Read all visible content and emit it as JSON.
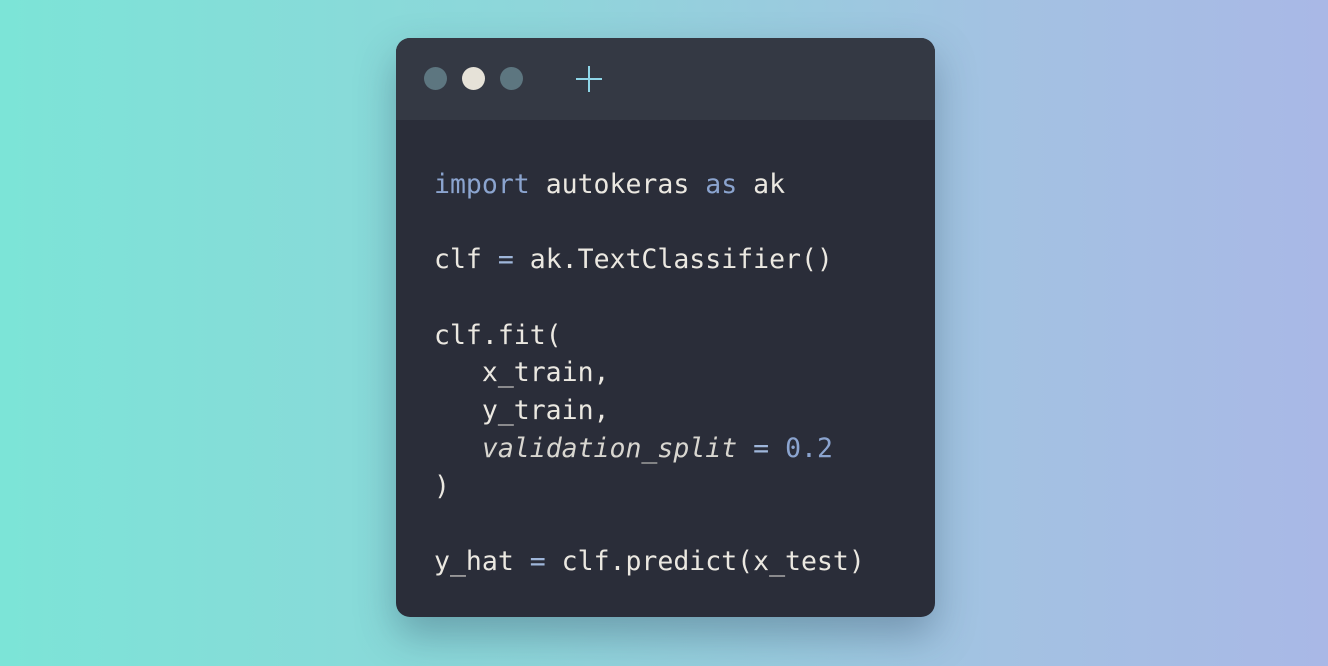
{
  "window": {
    "controls": [
      {
        "name": "close-dot",
        "color": "#5d7680"
      },
      {
        "name": "minimize-dot",
        "color": "#e6e2d8"
      },
      {
        "name": "maximize-dot",
        "color": "#5d7680"
      }
    ],
    "new_tab_icon": "plus-icon",
    "new_tab_color": "#8fd6e8"
  },
  "code_lines": [
    [
      {
        "t": "import",
        "c": "kw"
      },
      {
        "t": " autokeras ",
        "c": ""
      },
      {
        "t": "as",
        "c": "kw"
      },
      {
        "t": " ak",
        "c": ""
      }
    ],
    [],
    [
      {
        "t": "clf ",
        "c": ""
      },
      {
        "t": "=",
        "c": "op"
      },
      {
        "t": " ak.TextClassifier()",
        "c": ""
      }
    ],
    [],
    [
      {
        "t": "clf.fit(",
        "c": ""
      }
    ],
    [
      {
        "t": "   x_train,",
        "c": ""
      }
    ],
    [
      {
        "t": "   y_train,",
        "c": ""
      }
    ],
    [
      {
        "t": "   ",
        "c": ""
      },
      {
        "t": "validation_split",
        "c": "param"
      },
      {
        "t": " ",
        "c": ""
      },
      {
        "t": "=",
        "c": "op"
      },
      {
        "t": " ",
        "c": ""
      },
      {
        "t": "0.2",
        "c": "num"
      }
    ],
    [
      {
        "t": ")",
        "c": ""
      }
    ],
    [],
    [
      {
        "t": "y_hat ",
        "c": ""
      },
      {
        "t": "=",
        "c": "op"
      },
      {
        "t": " clf.predict(x_test)",
        "c": ""
      }
    ]
  ]
}
